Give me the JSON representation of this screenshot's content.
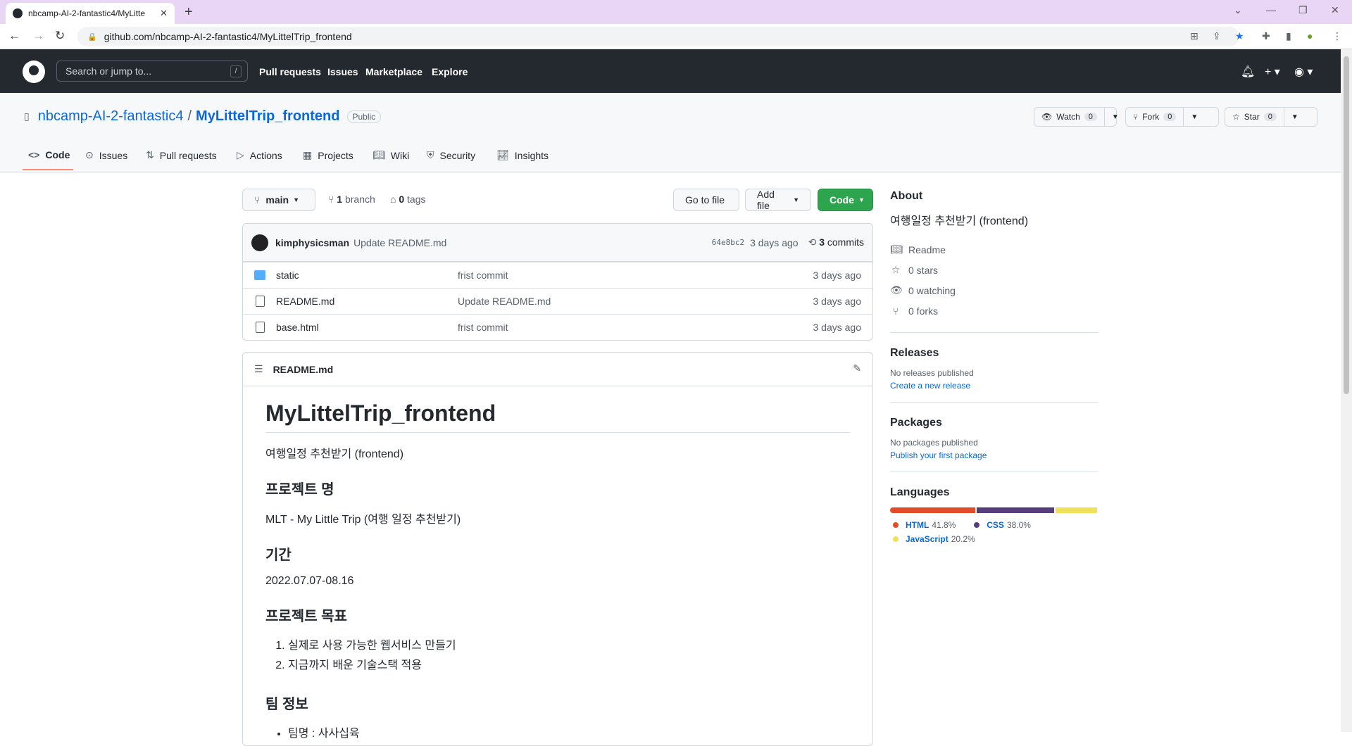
{
  "browser": {
    "tab_title": "nbcamp-AI-2-fantastic4/MyLitte",
    "new_tab": "+",
    "url": "github.com/nbcamp-AI-2-fantastic4/MyLittelTrip_frontend"
  },
  "header": {
    "search_placeholder": "Search or jump to...",
    "search_shortcut": "/",
    "nav": [
      "Pull requests",
      "Issues",
      "Marketplace",
      "Explore"
    ]
  },
  "repo": {
    "owner": "nbcamp-AI-2-fantastic4",
    "separator": "/",
    "name": "MyLittelTrip_frontend",
    "visibility": "Public",
    "watch_label": "Watch",
    "watch_count": "0",
    "fork_label": "Fork",
    "fork_count": "0",
    "star_label": "Star",
    "star_count": "0",
    "tabs": [
      "Code",
      "Issues",
      "Pull requests",
      "Actions",
      "Projects",
      "Wiki",
      "Security",
      "Insights"
    ]
  },
  "toolbar": {
    "branch": "main",
    "branches_count": "1",
    "branches_label": "branch",
    "tags_count": "0",
    "tags_label": "tags",
    "goto_file": "Go to file",
    "add_file": "Add file",
    "code": "Code"
  },
  "commit": {
    "author": "kimphysicsman",
    "message": "Update README.md",
    "sha": "64e8bc2",
    "ago": "3 days ago",
    "count": "3",
    "count_label": "commits"
  },
  "files": [
    {
      "type": "folder",
      "name": "static",
      "message": "frist commit",
      "age": "3 days ago"
    },
    {
      "type": "file",
      "name": "README.md",
      "message": "Update README.md",
      "age": "3 days ago"
    },
    {
      "type": "file",
      "name": "base.html",
      "message": "frist commit",
      "age": "3 days ago"
    }
  ],
  "readme": {
    "filename": "README.md",
    "title": "MyLittelTrip_frontend",
    "intro": "여행일정 추천받기 (frontend)",
    "h_project": "프로젝트 명",
    "project_name": "MLT - My Little Trip (여행 일정 추천받기)",
    "h_period": "기간",
    "period": "2022.07.07-08.16",
    "h_goal": "프로젝트 목표",
    "goals": [
      "실제로 사용 가능한 웹서비스 만들기",
      "지금까지 배운 기술스택 적용"
    ],
    "h_team": "팀 정보",
    "team": [
      "팀명 : 사사십육"
    ]
  },
  "about": {
    "heading": "About",
    "description": "여행일정 추천받기 (frontend)",
    "readme": "Readme",
    "stars": "0 stars",
    "watching": "0 watching",
    "forks": "0 forks"
  },
  "releases": {
    "heading": "Releases",
    "none": "No releases published",
    "link": "Create a new release"
  },
  "packages": {
    "heading": "Packages",
    "none": "No packages published",
    "link": "Publish your first package"
  },
  "languages": {
    "heading": "Languages",
    "items": [
      {
        "name": "HTML",
        "pct": "41.8%",
        "value": 41.8,
        "color": "#e34c26"
      },
      {
        "name": "CSS",
        "pct": "38.0%",
        "value": 38.0,
        "color": "#563d7c"
      },
      {
        "name": "JavaScript",
        "pct": "20.2%",
        "value": 20.2,
        "color": "#f1e05a"
      }
    ]
  }
}
